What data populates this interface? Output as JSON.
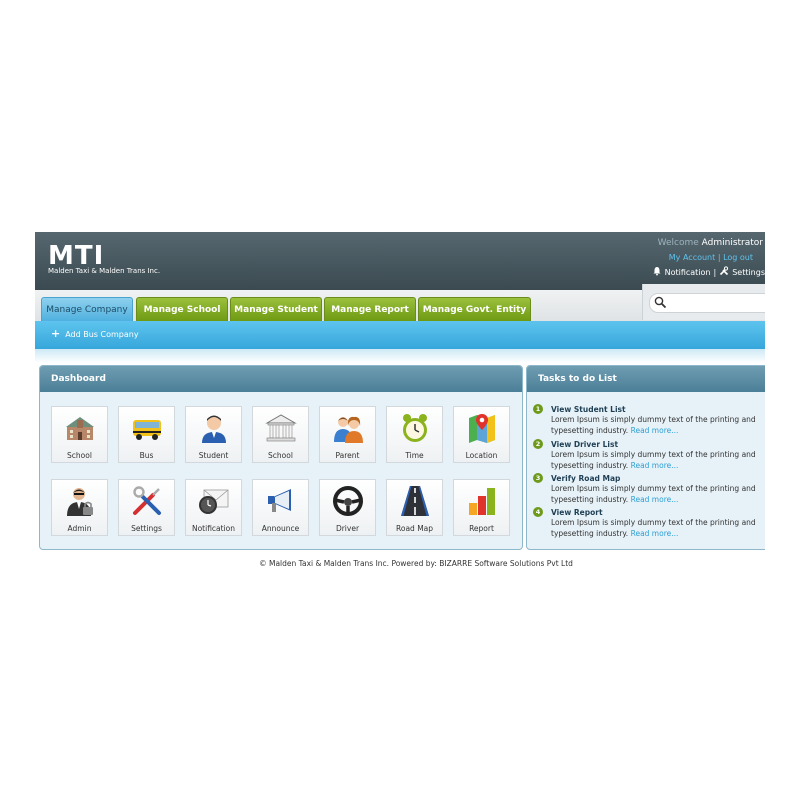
{
  "header": {
    "logo_text": "MTI",
    "logo_subtitle": "Malden Taxi & Malden Trans Inc.",
    "welcome_label": "Welcome",
    "username": "Administrator",
    "my_account": "My Account",
    "separator": "|",
    "logout": "Log out",
    "notification_label": "Notification",
    "settings_label": "Settings"
  },
  "tabs": [
    {
      "label": "Manage Company",
      "active": true
    },
    {
      "label": "Manage School",
      "active": false
    },
    {
      "label": "Manage Student",
      "active": false
    },
    {
      "label": "Manage Report",
      "active": false
    },
    {
      "label": "Manage Govt. Entity",
      "active": false
    }
  ],
  "search": {
    "placeholder": ""
  },
  "toolbar": {
    "add_label": "Add Bus Company"
  },
  "dashboard": {
    "title": "Dashboard",
    "tiles": [
      {
        "label": "School",
        "icon": "school-building-icon"
      },
      {
        "label": "Bus",
        "icon": "bus-icon"
      },
      {
        "label": "Student",
        "icon": "student-icon"
      },
      {
        "label": "School",
        "icon": "school-columns-icon"
      },
      {
        "label": "Parent",
        "icon": "parent-icon"
      },
      {
        "label": "Time",
        "icon": "alarm-clock-icon"
      },
      {
        "label": "Location",
        "icon": "map-pin-icon"
      },
      {
        "label": "Admin",
        "icon": "admin-icon"
      },
      {
        "label": "Settings",
        "icon": "tools-icon"
      },
      {
        "label": "Notification",
        "icon": "notification-icon"
      },
      {
        "label": "Announce",
        "icon": "megaphone-icon"
      },
      {
        "label": "Driver",
        "icon": "steering-wheel-icon"
      },
      {
        "label": "Road Map",
        "icon": "road-icon"
      },
      {
        "label": "Report",
        "icon": "bar-chart-icon"
      }
    ]
  },
  "tasks": {
    "title": "Tasks to do List",
    "read_more": "Read more...",
    "items": [
      {
        "num": "1",
        "title": "View Student List",
        "desc": "Lorem Ipsum is simply dummy text of the printing and typesetting industry."
      },
      {
        "num": "2",
        "title": "View Driver List",
        "desc": "Lorem Ipsum is simply dummy text of the printing and typesetting industry."
      },
      {
        "num": "3",
        "title": "Verify Road Map",
        "desc": "Lorem Ipsum is simply dummy text of the printing and typesetting industry."
      },
      {
        "num": "4",
        "title": "View Report",
        "desc": "Lorem Ipsum is simply dummy text of the printing and typesetting industry."
      }
    ]
  },
  "footer": {
    "text": "© Malden Taxi & Malden Trans Inc. Powered by: BIZARRE Software Solutions Pvt Ltd"
  },
  "colors": {
    "header_bg": "#3b4a51",
    "tab_green": "#7aa51a",
    "tab_active_blue": "#4fb0df",
    "toolbar_blue": "#36a6db",
    "panel_head": "#4b7f98",
    "link_blue": "#2d9fd3"
  }
}
